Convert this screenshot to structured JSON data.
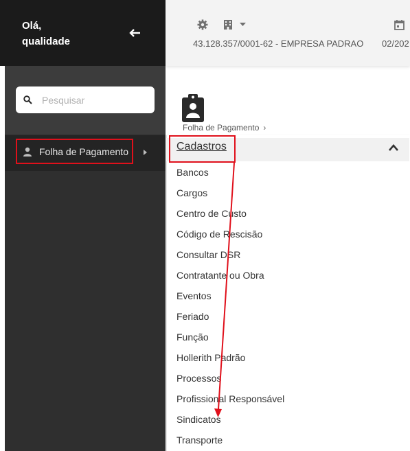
{
  "sidebar": {
    "greeting_line1": "Olá,",
    "greeting_line2": "qualidade",
    "back_icon": "arrow-left-icon",
    "search": {
      "placeholder": "Pesquisar",
      "value": ""
    },
    "menu_item": {
      "label": "Folha de Pagamento",
      "icon": "person-icon"
    }
  },
  "header": {
    "company": "43.128.357/0001-62 - EMPRESA PADRAO",
    "date": "02/202",
    "icons": [
      "gear-icon",
      "building-icon",
      "calendar-icon"
    ]
  },
  "content": {
    "breadcrumb": "Folha de Pagamento",
    "page_icon": "clipboard-person-icon"
  },
  "dropdown": {
    "title": "Cadastros",
    "items": [
      "Bancos",
      "Cargos",
      "Centro de Custo",
      "Código de Rescisão",
      "Consultar DSR",
      "Contratante ou Obra",
      "Eventos",
      "Feriado",
      "Função",
      "Hollerith Padrão",
      "Processos",
      "Profissional Responsável",
      "Sindicatos",
      "Transporte"
    ]
  },
  "colors": {
    "sidebar_dark": "#1b1b1b",
    "sidebar_body": "#2f2f2f",
    "highlight_red": "#e0101b",
    "header_bg": "#f3f3f3"
  }
}
